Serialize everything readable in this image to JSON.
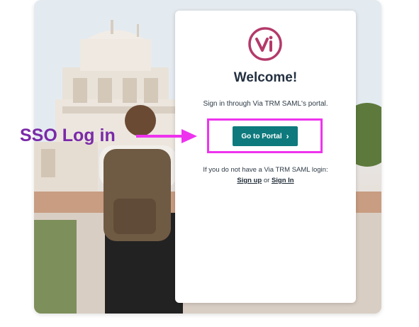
{
  "login_card": {
    "logo_text": "vi",
    "welcome_title": "Welcome!",
    "subtitle": "Sign in through Via TRM SAML's portal.",
    "portal_button_label": "Go to Portal",
    "no_login_text": "If you do not have a Via TRM SAML login:",
    "sign_up_label": "Sign up",
    "or_text": " or ",
    "sign_in_label": "Sign In"
  },
  "annotation": {
    "label": "SSO Log in"
  },
  "colors": {
    "brand_logo": "#b43a6b",
    "portal_button": "#0e7a7d",
    "annotation_text": "#7a2aa8",
    "annotation_highlight": "#ee33ee"
  },
  "icons": {
    "logo": "via-logo-icon",
    "button_chevron": "chevron-right-icon",
    "annotation_arrow": "arrow-right-icon"
  }
}
